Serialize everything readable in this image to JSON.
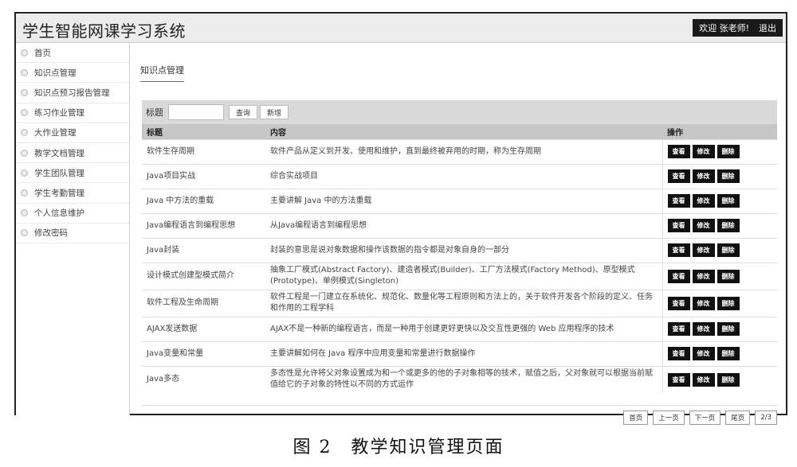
{
  "app": {
    "title": "学生智能网课学习系统"
  },
  "user": {
    "welcome": "欢迎 张老师!",
    "logout": "退出"
  },
  "sidebar": {
    "items": [
      {
        "label": "首页"
      },
      {
        "label": "知识点管理"
      },
      {
        "label": "知识点预习报告管理"
      },
      {
        "label": "练习作业管理"
      },
      {
        "label": "大作业管理"
      },
      {
        "label": "教学文档管理"
      },
      {
        "label": "学生团队管理"
      },
      {
        "label": "学生考勤管理"
      },
      {
        "label": "个人信息维护"
      },
      {
        "label": "修改密码"
      }
    ]
  },
  "page": {
    "breadcrumb": "知识点管理"
  },
  "search": {
    "label": "标题",
    "value": "",
    "query_label": "查询",
    "add_label": "新增"
  },
  "table": {
    "headers": {
      "title": "标题",
      "content": "内容",
      "actions": "操作"
    },
    "action_labels": {
      "view": "查看",
      "edit": "修改",
      "delete": "删除"
    },
    "rows": [
      {
        "title": "软件生存周期",
        "content": "软件产品从定义到开发、使用和维护，直到最终被弃用的时期，称为生存周期"
      },
      {
        "title": "Java项目实战",
        "content": "综合实战项目"
      },
      {
        "title": "Java 中方法的重载",
        "content": "主要讲解 Java 中的方法重载"
      },
      {
        "title": "Java编程语言到编程思想",
        "content": "从Java编程语言到编程思想"
      },
      {
        "title": "Java封装",
        "content": "封装的意思是说对象数据和操作该数据的指令都是对象自身的一部分"
      },
      {
        "title": "设计模式创建型模式简介",
        "content": "抽象工厂模式(Abstract Factory)、建造者模式(Builder)、工厂方法模式(Factory Method)、原型模式(Prototype)、单例模式(Singleton)"
      },
      {
        "title": "软件工程及生命周期",
        "content": "软件工程是一门建立在系统化、规范化、数量化等工程原则和方法上的，关于软件开发各个阶段的定义、任务和作用的工程学科"
      },
      {
        "title": "AJAX发送数据",
        "content": "AJAX不是一种新的编程语言，而是一种用于创建更好更快以及交互性更强的 Web 应用程序的技术"
      },
      {
        "title": "Java变量和常量",
        "content": "主要讲解如何在 Java 程序中应用变量和常量进行数据操作"
      },
      {
        "title": "Java多态",
        "content": "多态性是允许将父对象设置成为和一个或更多的他的子对象相等的技术，赋值之后，父对象就可以根据当前赋值给它的子对象的特性以不同的方式运作"
      }
    ]
  },
  "pager": {
    "first": "首页",
    "prev": "上一页",
    "next": "下一页",
    "last": "尾页",
    "page_info": "2/3"
  },
  "caption": "图 2　教学知识管理页面"
}
